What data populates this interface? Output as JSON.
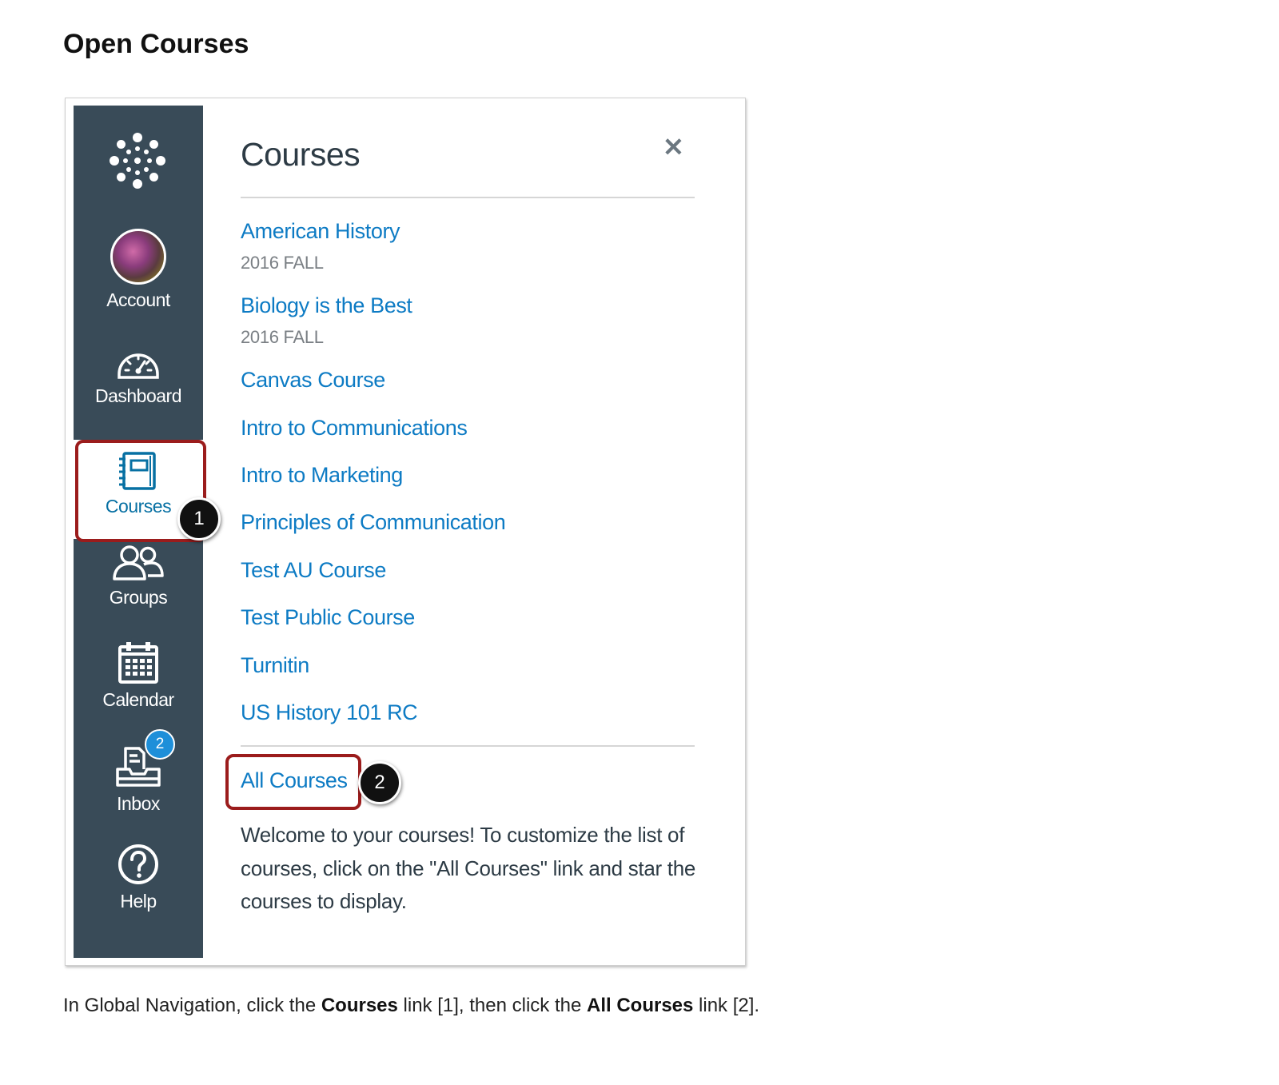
{
  "page": {
    "title": "Open Courses",
    "caption": {
      "p1": "In Global Navigation, click the ",
      "b1": "Courses",
      "p2": " link [1], then click the ",
      "b2": "All Courses",
      "p3": " link [2]."
    }
  },
  "global_nav": {
    "items": [
      {
        "label": "Account",
        "icon": "avatar"
      },
      {
        "label": "Dashboard",
        "icon": "dashboard-icon"
      },
      {
        "label": "Courses",
        "icon": "courses-icon",
        "active": true
      },
      {
        "label": "Groups",
        "icon": "groups-icon"
      },
      {
        "label": "Calendar",
        "icon": "calendar-icon"
      },
      {
        "label": "Inbox",
        "icon": "inbox-icon",
        "badge": "2"
      },
      {
        "label": "Help",
        "icon": "help-icon"
      }
    ]
  },
  "tray": {
    "title": "Courses",
    "close_icon": "close-icon",
    "courses": [
      {
        "name": "American History",
        "term": "2016 FALL"
      },
      {
        "name": "Biology is the Best",
        "term": "2016 FALL"
      },
      {
        "name": "Canvas Course"
      },
      {
        "name": "Intro to Communications"
      },
      {
        "name": "Intro to Marketing"
      },
      {
        "name": "Principles of Communication"
      },
      {
        "name": "Test AU Course"
      },
      {
        "name": "Test Public Course"
      },
      {
        "name": "Turnitin"
      },
      {
        "name": "US History 101 RC"
      }
    ],
    "all_courses_label": "All Courses",
    "welcome_text": "Welcome to your courses! To customize the list of courses, click on the \"All Courses\" link and star the courses to display."
  },
  "callouts": [
    "1",
    "2"
  ],
  "colors": {
    "nav_background": "#394b58",
    "link": "#0d7bc4",
    "active_nav_text": "#0770a3",
    "highlight": "#9b1c1c",
    "badge": "#1e8fd9"
  }
}
